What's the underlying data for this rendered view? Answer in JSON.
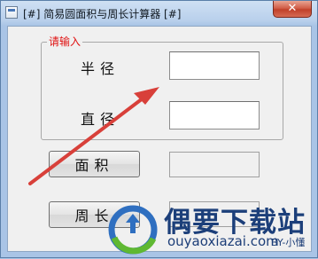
{
  "window": {
    "title": "[#] 简易圆面积与周长计算器 [#]",
    "close_symbol": "✕"
  },
  "groupbox": {
    "title": "请输入"
  },
  "inputs": {
    "radius_label": "半径",
    "radius_value": "",
    "diameter_label": "直径",
    "diameter_value": ""
  },
  "buttons": {
    "area_label": "面积",
    "perimeter_label": "周长"
  },
  "outputs": {
    "area_value": "",
    "perimeter_value": ""
  },
  "watermark": {
    "site_name": "偶要下载站",
    "url": "ouyaoxiazai.com",
    "byline": "BY-小懂"
  },
  "colors": {
    "groupbox_title": "#e01010",
    "annotation_arrow": "#d8403a",
    "watermark_text": "#1c3f7a"
  }
}
